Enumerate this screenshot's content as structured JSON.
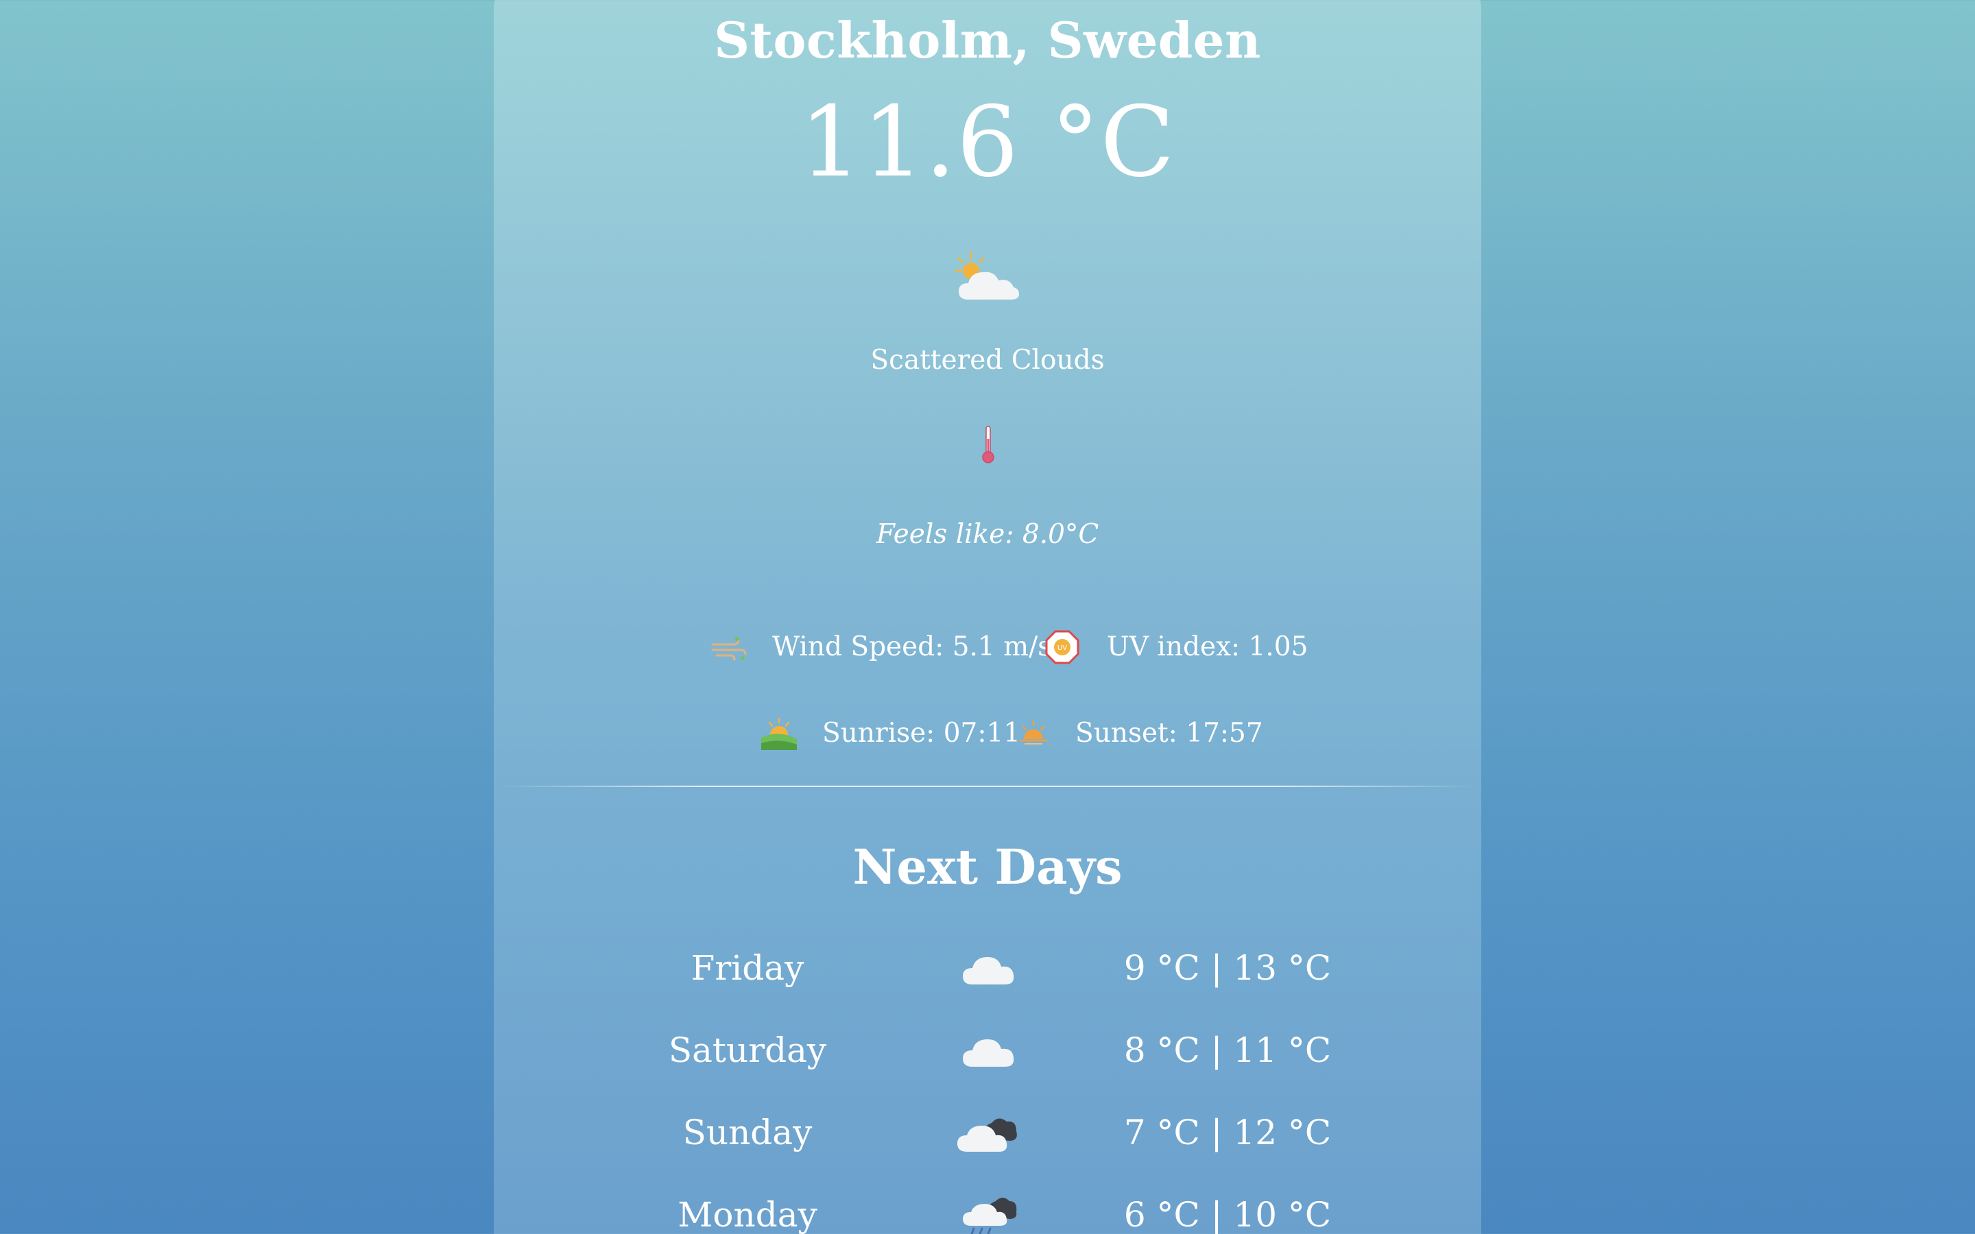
{
  "current": {
    "city": "Stockholm, Sweden",
    "temperature": "11.6 °C",
    "weather_icon": "partly-cloudy-icon",
    "description": "Scattered Clouds",
    "thermometer_icon": "thermometer-icon",
    "feels_like": "Feels like: 8.0°C",
    "wind_icon": "wind-icon",
    "wind_speed": "Wind Speed: 5.1 m/s",
    "uv_icon": "uv-icon",
    "uv_index": "UV index: 1.05",
    "sunrise_icon": "sunrise-icon",
    "sunrise": "Sunrise: 07:11",
    "sunset_icon": "sunset-icon",
    "sunset": "Sunset: 17:57"
  },
  "forecast": {
    "title": "Next Days",
    "days": [
      {
        "day": "Friday",
        "icon": "cloud-icon",
        "temps": "9 °C | 13 °C"
      },
      {
        "day": "Saturday",
        "icon": "cloud-icon",
        "temps": "8 °C | 11 °C"
      },
      {
        "day": "Sunday",
        "icon": "broken-clouds-icon",
        "temps": "7 °C | 12 °C"
      },
      {
        "day": "Monday",
        "icon": "rain-cloud-icon",
        "temps": "6 °C | 10 °C"
      }
    ]
  },
  "colors": {
    "background_top": "#82c4cc",
    "background_bottom": "#4a87c0",
    "text": "#ffffff",
    "sun": "#f2b33d",
    "thermometer": "#e05a7a",
    "uv_ring": "#e04848"
  }
}
